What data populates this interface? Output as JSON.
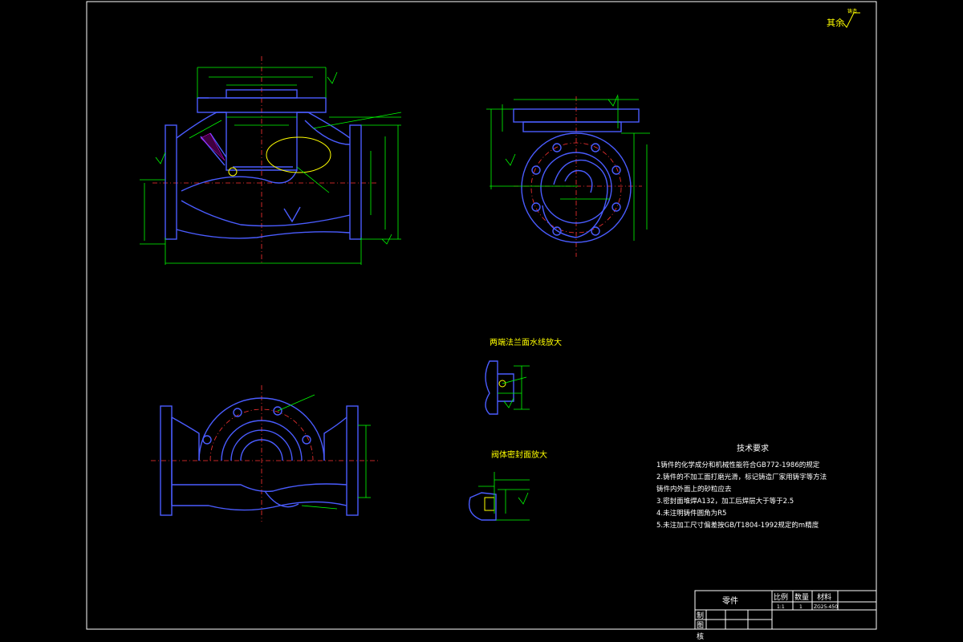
{
  "corner_note": {
    "label": "其余",
    "symbol": "铸造"
  },
  "detail_titles": {
    "flange_seal": "两端法兰面水线放大",
    "body_seal": "阀体密封面放大"
  },
  "tech_req": {
    "title": "技术要求",
    "lines": [
      "1铸件的化学成分和机械性能符合GB772-1986的规定",
      "2.铸件的不加工面打磨光滑，标记铸造厂家用铸字等方法",
      "铸件内外面上的砂粒应去",
      "3.密封面堆焊A132，加工后焊层大于等于2.5",
      "4.未注明铸件圆角为R5",
      "5.未注加工尺寸偏差按GB/T1804-1992规定的m精度"
    ]
  },
  "title_block": {
    "part_name": "零件",
    "headers": [
      "比例",
      "数量",
      "材料"
    ],
    "values": [
      "1:1",
      "1",
      "ZG25-450"
    ],
    "roles": [
      "制",
      "图",
      "核"
    ]
  }
}
